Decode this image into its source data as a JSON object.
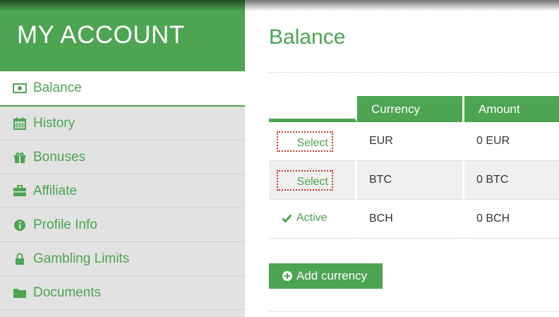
{
  "sidebar": {
    "title": "MY ACCOUNT",
    "items": [
      {
        "label": "Balance",
        "icon": "money-icon",
        "active": true
      },
      {
        "label": "History",
        "icon": "calendar-icon",
        "active": false
      },
      {
        "label": "Bonuses",
        "icon": "gift-icon",
        "active": false
      },
      {
        "label": "Affiliate",
        "icon": "briefcase-icon",
        "active": false
      },
      {
        "label": "Profile Info",
        "icon": "info-icon",
        "active": false
      },
      {
        "label": "Gambling Limits",
        "icon": "lock-icon",
        "active": false
      },
      {
        "label": "Documents",
        "icon": "folder-icon",
        "active": false
      }
    ]
  },
  "main": {
    "title": "Balance",
    "table": {
      "headers": [
        "",
        "Currency",
        "Amount"
      ],
      "rows": [
        {
          "action": "Select",
          "currency": "EUR",
          "amount": "0 EUR",
          "status": "select"
        },
        {
          "action": "Select",
          "currency": "BTC",
          "amount": "0 BTC",
          "status": "select"
        },
        {
          "action": "Active",
          "currency": "BCH",
          "amount": "0 BCH",
          "status": "active"
        }
      ]
    },
    "add_button": "Add currency"
  },
  "colors": {
    "accent": "#4da451",
    "sidebar_bg": "#e2e2e2",
    "select_outline": "#c0392b"
  }
}
